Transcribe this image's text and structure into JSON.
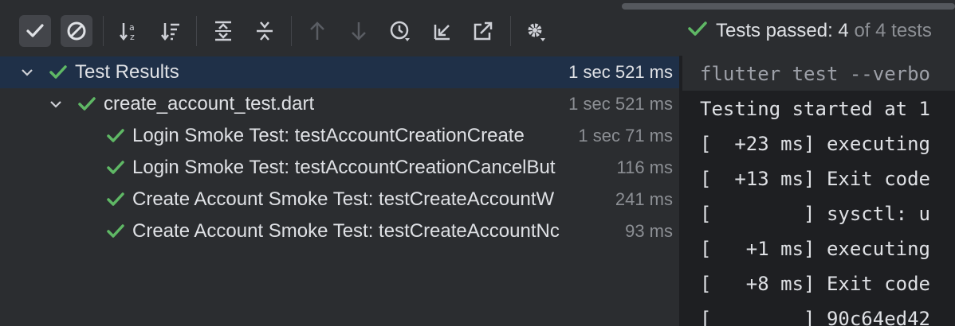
{
  "toolbar": {
    "buttons": [
      {
        "name": "show-passed-button",
        "icon": "check-icon"
      },
      {
        "name": "show-ignored-button",
        "icon": "ban-icon"
      },
      {
        "name": "sort-alphabetically-button",
        "icon": "sort-az-icon"
      },
      {
        "name": "sort-by-duration-button",
        "icon": "sort-duration-icon"
      },
      {
        "name": "expand-all-button",
        "icon": "expand-all-icon"
      },
      {
        "name": "collapse-all-button",
        "icon": "collapse-all-icon"
      },
      {
        "name": "previous-failed-button",
        "icon": "arrow-up-icon"
      },
      {
        "name": "next-failed-button",
        "icon": "arrow-down-icon"
      },
      {
        "name": "test-history-button",
        "icon": "history-icon"
      },
      {
        "name": "import-tests-button",
        "icon": "import-icon"
      },
      {
        "name": "export-results-button",
        "icon": "export-icon"
      },
      {
        "name": "settings-button",
        "icon": "gear-icon"
      }
    ],
    "status": {
      "prefix": "Tests passed: ",
      "count": "4",
      "suffix": " of 4 tests"
    }
  },
  "tree": {
    "rows": [
      {
        "label": "Test Results",
        "time": "1 sec 521 ms",
        "level": 0,
        "expanded": true,
        "selected": true
      },
      {
        "label": "create_account_test.dart",
        "time": "1 sec 521 ms",
        "level": 1,
        "expanded": true,
        "selected": false
      },
      {
        "label": "Login Smoke Test: testAccountCreationCreate",
        "time": "1 sec 71 ms",
        "level": 2,
        "selected": false
      },
      {
        "label": "Login Smoke Test: testAccountCreationCancelBut",
        "time": "116 ms",
        "level": 2,
        "selected": false
      },
      {
        "label": "Create Account Smoke Test: testCreateAccountW",
        "time": "241 ms",
        "level": 2,
        "selected": false
      },
      {
        "label": "Create Account Smoke Test: testCreateAccountNc",
        "time": "93 ms",
        "level": 2,
        "selected": false
      }
    ]
  },
  "console": {
    "lines": [
      "flutter test --verbo",
      "Testing started at 1",
      "[  +23 ms] executing",
      "[  +13 ms] Exit code",
      "[        ] sysctl: u",
      "[   +1 ms] executing",
      "[   +8 ms] Exit code",
      "[        ] 90c64ed42"
    ]
  },
  "colors": {
    "accent_green": "#5fb865",
    "selection": "#1f3048"
  }
}
